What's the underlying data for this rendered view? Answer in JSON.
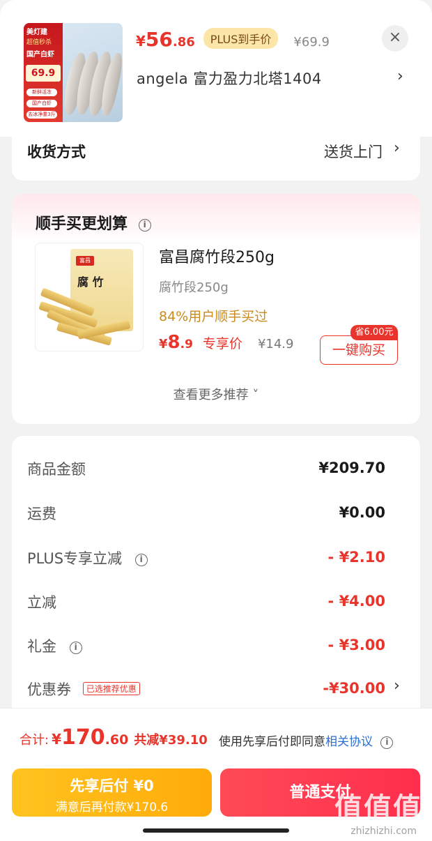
{
  "header": {
    "thumb": {
      "brand": "美灯建",
      "tag1": "超值秒杀",
      "tag2": "国产白虾",
      "price": "69.9",
      "chips": [
        "新鲜活冻",
        "国产白虾",
        "去冰净重3斤"
      ]
    },
    "price": {
      "currency": "¥",
      "int": "56",
      "dec": ".86"
    },
    "plus_badge": "PLUS到手价",
    "orig_price": "¥69.9",
    "close": "×",
    "address": "angela  富力盈力北塔1404",
    "chevron": "›"
  },
  "delivery": {
    "label": "收货方式",
    "value": "送货上门",
    "chevron": "›"
  },
  "reco": {
    "title": "顺手买更划算",
    "info_icon": "i",
    "bag_logo": "富昌",
    "bag_text": "腐 竹",
    "name": "富昌腐竹段250g",
    "spec": "腐竹段250g",
    "stat": "84%用户顺手买过",
    "price": {
      "currency": "¥",
      "int": "8",
      "dec": ".9"
    },
    "exclusive": "专享价",
    "orig": "¥14.9",
    "save_tag": "省6.00元",
    "buy": "一键购买",
    "more": "查看更多推荐 ˅"
  },
  "summary": {
    "rows": [
      {
        "label": "商品金额",
        "value": "¥209.70"
      },
      {
        "label": "运费",
        "value": "¥0.00"
      },
      {
        "label": "PLUS专享立减",
        "value": "- ¥2.10"
      },
      {
        "label": "立减",
        "value": "- ¥4.00"
      },
      {
        "label": "礼金",
        "value": "- ¥3.00"
      },
      {
        "label": "优惠券",
        "value": "-¥30.00"
      }
    ],
    "coupon_tag": "已选推荐优惠",
    "info_icon": "i",
    "chevron": "›"
  },
  "bottom": {
    "total_label": "合计:",
    "total": {
      "currency": "¥",
      "int": "170",
      "dec": ".60"
    },
    "saved": "共减¥39.10",
    "agree_prefix": "使用先享后付即同意",
    "agree_link": "相关协议",
    "info_icon": "i",
    "bnpl_line1": "先享后付 ¥0",
    "bnpl_line2": "满意后再付款¥170.6",
    "pay": "普通支付"
  },
  "watermark": {
    "big": "值值值",
    "small": "zhizhizhi.com"
  },
  "colors": {
    "accent_red": "#e9342b",
    "plus_gold": "#fbe6a8",
    "bnpl_yellow": "#ffb514",
    "link_blue": "#2a6fd6"
  }
}
